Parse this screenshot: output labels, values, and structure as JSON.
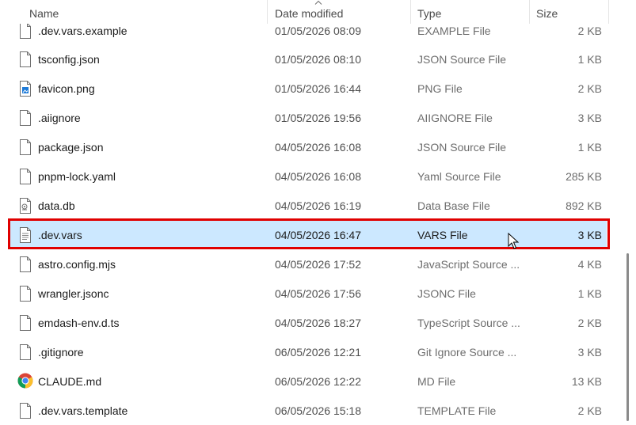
{
  "columns": {
    "name": "Name",
    "date_modified": "Date modified",
    "type": "Type",
    "size": "Size"
  },
  "files": [
    {
      "name": ".dev.vars.example",
      "date": "01/05/2026 08:09",
      "type": "EXAMPLE File",
      "size": "2 KB",
      "icon": "generic-file-icon"
    },
    {
      "name": "tsconfig.json",
      "date": "01/05/2026 08:10",
      "type": "JSON Source File",
      "size": "1 KB",
      "icon": "generic-file-icon"
    },
    {
      "name": "favicon.png",
      "date": "01/05/2026 16:44",
      "type": "PNG File",
      "size": "2 KB",
      "icon": "image-file-icon"
    },
    {
      "name": ".aiignore",
      "date": "01/05/2026 19:56",
      "type": "AIIGNORE File",
      "size": "3 KB",
      "icon": "generic-file-icon"
    },
    {
      "name": "package.json",
      "date": "04/05/2026 16:08",
      "type": "JSON Source File",
      "size": "1 KB",
      "icon": "generic-file-icon"
    },
    {
      "name": "pnpm-lock.yaml",
      "date": "04/05/2026 16:08",
      "type": "Yaml Source File",
      "size": "285 KB",
      "icon": "generic-file-icon"
    },
    {
      "name": "data.db",
      "date": "04/05/2026 16:19",
      "type": "Data Base File",
      "size": "892 KB",
      "icon": "database-file-icon"
    },
    {
      "name": ".dev.vars",
      "date": "04/05/2026 16:47",
      "type": "VARS File",
      "size": "3 KB",
      "icon": "text-file-icon",
      "selected": true
    },
    {
      "name": "astro.config.mjs",
      "date": "04/05/2026 17:52",
      "type": "JavaScript Source ...",
      "size": "4 KB",
      "icon": "generic-file-icon"
    },
    {
      "name": "wrangler.jsonc",
      "date": "04/05/2026 17:56",
      "type": "JSONC File",
      "size": "1 KB",
      "icon": "generic-file-icon"
    },
    {
      "name": "emdash-env.d.ts",
      "date": "04/05/2026 18:27",
      "type": "TypeScript Source ...",
      "size": "2 KB",
      "icon": "generic-file-icon"
    },
    {
      "name": ".gitignore",
      "date": "06/05/2026 12:21",
      "type": "Git Ignore Source ...",
      "size": "3 KB",
      "icon": "generic-file-icon"
    },
    {
      "name": "CLAUDE.md",
      "date": "06/05/2026 12:22",
      "type": "MD File",
      "size": "13 KB",
      "icon": "chrome-icon"
    },
    {
      "name": ".dev.vars.template",
      "date": "06/05/2026 15:18",
      "type": "TEMPLATE File",
      "size": "2 KB",
      "icon": "generic-file-icon"
    }
  ],
  "colors": {
    "selection": "#cce8ff",
    "highlight_outline": "#e00000"
  }
}
